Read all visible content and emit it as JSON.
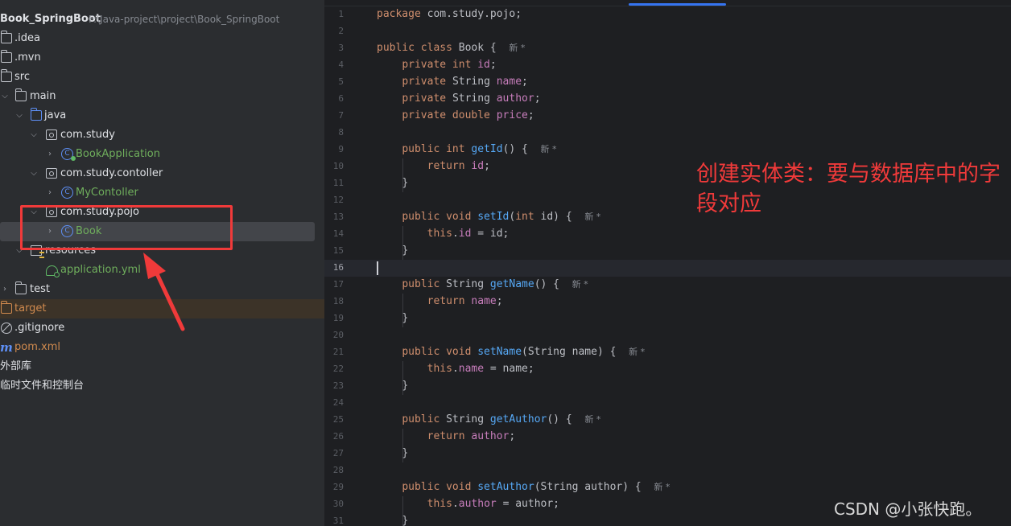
{
  "project": {
    "name": "Book_SpringBoot",
    "path": "F:\\Java-project\\project\\Book_SpringBoot",
    "items": [
      {
        "label": ".idea",
        "icon": "folder-icon"
      },
      {
        "label": ".mvn",
        "icon": "folder-icon"
      },
      {
        "label": "src",
        "icon": "folder-icon"
      },
      {
        "label": "main",
        "icon": "folder-icon"
      },
      {
        "label": "java",
        "icon": "source-folder-icon"
      },
      {
        "label": "com.study",
        "icon": "package-icon"
      },
      {
        "label": "BookApplication",
        "icon": "spring-boot-class-icon"
      },
      {
        "label": "com.study.contoller",
        "icon": "package-icon"
      },
      {
        "label": "MyContoller",
        "icon": "class-icon"
      },
      {
        "label": "com.study.pojo",
        "icon": "package-icon"
      },
      {
        "label": "Book",
        "icon": "class-icon"
      },
      {
        "label": "resources",
        "icon": "resources-folder-icon"
      },
      {
        "label": "application.yml",
        "icon": "yaml-file-icon"
      },
      {
        "label": "test",
        "icon": "folder-icon"
      },
      {
        "label": "target",
        "icon": "excluded-folder-icon"
      },
      {
        "label": ".gitignore",
        "icon": "ignore-file-icon"
      },
      {
        "label": "pom.xml",
        "icon": "maven-icon"
      },
      {
        "label": "外部库",
        "icon": "external-libraries"
      },
      {
        "label": "临时文件和控制台",
        "icon": "scratches"
      }
    ]
  },
  "editor": {
    "current_line": 16,
    "hint": "新 *",
    "line_numbers": [
      "1",
      "2",
      "3",
      "4",
      "5",
      "6",
      "7",
      "8",
      "9",
      "10",
      "11",
      "12",
      "13",
      "14",
      "15",
      "16",
      "17",
      "18",
      "19",
      "20",
      "21",
      "22",
      "23",
      "24",
      "25",
      "26",
      "27",
      "28",
      "29",
      "30",
      "31"
    ],
    "code": {
      "l1_package": "package",
      "l1_name": "com.study.pojo;",
      "l3_public": "public",
      "l3_class": "class",
      "l3_name": "Book {",
      "l4": "private int",
      "l4_f": "id",
      "l4_end": ";",
      "l5": "private",
      "l5_t": "String",
      "l5_f": "name",
      "l5_end": ";",
      "l6": "private",
      "l6_t": "String",
      "l6_f": "author",
      "l6_end": ";",
      "l7": "private double",
      "l7_f": "price",
      "l7_end": ";",
      "l9": "public int",
      "l9_fn": "getId",
      "l9_end": "() {",
      "l10": "return",
      "l10_f": "id",
      "l10_end": ";",
      "close": "}",
      "l13": "public void",
      "l13_fn": "setId",
      "l13_p": "(",
      "l13_kw": "int",
      "l13_end": "id) {",
      "l14_this": "this",
      "l14_dot": ".",
      "l14_f": "id",
      "l14_end": "= id;",
      "l17": "public",
      "l17_t": "String",
      "l17_fn": "getName",
      "l17_end": "() {",
      "l18": "return",
      "l18_f": "name",
      "l18_end": ";",
      "l21": "public void",
      "l21_fn": "setName",
      "l21_end": "(String name) {",
      "l22_this": "this",
      "l22_f": "name",
      "l22_end": "= name;",
      "l25": "public",
      "l25_t": "String",
      "l25_fn": "getAuthor",
      "l25_end": "() {",
      "l26": "return",
      "l26_f": "author",
      "l26_end": ";",
      "l29": "public void",
      "l29_fn": "setAuthor",
      "l29_end": "(String author) {",
      "l30_this": "this",
      "l30_f": "author",
      "l30_end": "= author;"
    }
  },
  "annotation": "创建实体类：要与数据库中的字段对应",
  "watermark": "CSDN @小张快跑。",
  "colors": {
    "highlight_box": "#f03a3a",
    "arrow": "#f03a3a",
    "keyword": "#cf8e6d",
    "field": "#c77dbb",
    "function": "#56a8f5"
  }
}
